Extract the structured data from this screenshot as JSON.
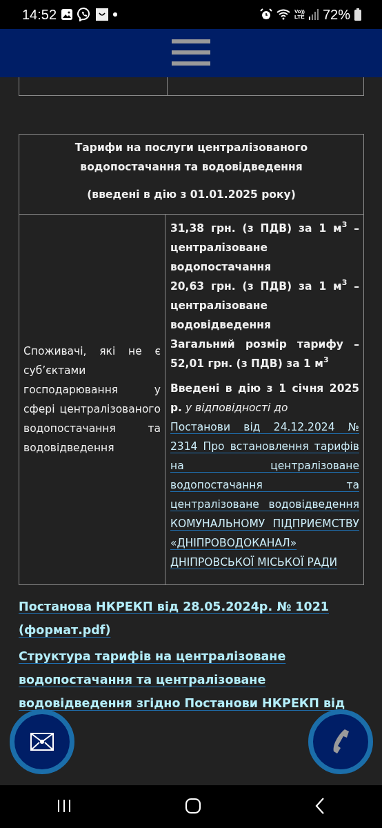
{
  "status_bar": {
    "time": "14:52",
    "network_top": "Vo))",
    "network_bottom": "LTE",
    "battery": "72%"
  },
  "tariff_table": {
    "title": "Тарифи на послуги централізованого водопостачання та водовідведення",
    "subtitle": "(введені в дію з 01.01.2025 року)",
    "consumer": "Споживачі, які не є суб’єктами господарювання у сфері централізованого водопостачання та водовідведення",
    "tariff_lines": [
      "31,38 грн. (з ПДВ) за 1 м$^{3}$ – централізоване водопостачання",
      "20,63 грн. (з ПДВ) за 1 м$^{3}$ – централізоване водовідведення",
      "Загальний розмір тарифу – 52,01 грн. (з ПДВ) за 1 м$^{3}$"
    ],
    "effective_note": "**Введені в дію з 1 січня 2025 р.** *у відповідності до*",
    "resolution_link": "Постанови від 24.12.2024 № 2314 Про встановлення тарифів на централізоване водопостачання та централізоване водовідведення КОМУНАЛЬНОМУ ПІДПРИЄМСТВУ «ДНІПРОВОДОКАНАЛ» ДНІПРОВСЬКОЇ МІСЬКОЇ РАДИ"
  },
  "links": [
    "Постанова НКРЕКП від 28.05.2024р. № 1021 (формат.pdf)",
    "Структура тарифів на централізоване водопостачання та централізоване водовідведення згідно Постанови НКРЕКП від"
  ],
  "floating_buttons": [
    {
      "kind": "mail"
    },
    {
      "kind": "phone"
    }
  ]
}
